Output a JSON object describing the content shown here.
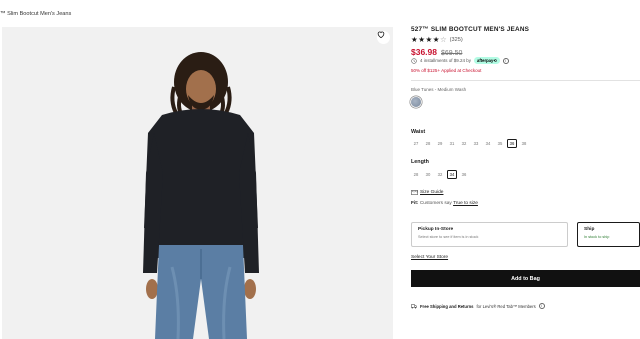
{
  "breadcrumb": "™ Slim Bootcut Men's Jeans",
  "product": {
    "title": "527™ SLIM BOOTCUT MEN'S JEANS",
    "rating": 4,
    "review_count": "(325)",
    "sale_price": "$36.98",
    "original_price": "$69.50",
    "afterpay_text": "4 installments of $9.24 by",
    "afterpay_badge": "afterpay⟲",
    "promo": "50% off $125+ Applied at Checkout",
    "color_name": "Blue Tunes - Medium Wash",
    "swatch_color": "#8c9aae"
  },
  "waist": {
    "label": "Waist",
    "sizes": [
      "27",
      "28",
      "29",
      "31",
      "32",
      "33",
      "34",
      "35",
      "36",
      "38"
    ],
    "selected": "36"
  },
  "length": {
    "label": "Length",
    "sizes": [
      "28",
      "30",
      "32",
      "34",
      "36"
    ],
    "selected": "34"
  },
  "size_guide": "Size Guide",
  "fit": {
    "label": "Fit:",
    "text": "Customers say",
    "link": "True to size"
  },
  "fulfillment": {
    "pickup_title": "Pickup In-Store",
    "pickup_sub": "Select store to see if item is in stock",
    "ship_title": "Ship",
    "ship_sub": "In stock to ship"
  },
  "select_store": "Select Your Store",
  "add_to_bag": "Add to Bag",
  "shipping": {
    "bold": "Free Shipping and Returns",
    "rest": "for Levi's® Red Tab™ Members"
  },
  "colors": {
    "sale": "#c8102e",
    "accent_dark": "#111111",
    "afterpay": "#b2fce4"
  }
}
